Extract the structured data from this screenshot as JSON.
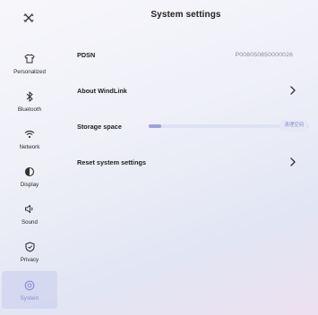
{
  "header": {
    "title": "System settings",
    "close_icon": "close-icon"
  },
  "sidebar": {
    "items": [
      {
        "label": "Personalized",
        "icon": "shirt-icon"
      },
      {
        "label": "Bluetooth",
        "icon": "bluetooth-icon"
      },
      {
        "label": "Network",
        "icon": "wifi-icon"
      },
      {
        "label": "Display",
        "icon": "display-icon"
      },
      {
        "label": "Sound",
        "icon": "speaker-icon"
      },
      {
        "label": "Privacy",
        "icon": "shield-icon"
      },
      {
        "label": "System",
        "icon": "system-icon",
        "active": true
      }
    ]
  },
  "main": {
    "pdsn": {
      "label": "PDSN",
      "value": "P008050850000026"
    },
    "about": {
      "label": "About WindLink"
    },
    "storage": {
      "label": "Storage space",
      "badge": "清理空间",
      "used_fraction": 0.08
    },
    "reset": {
      "label": "Reset system settings"
    }
  },
  "colors": {
    "accent": "#8a8ecf",
    "storage_fill": "#9da3d8",
    "active_bg": "#cdd2ee"
  }
}
